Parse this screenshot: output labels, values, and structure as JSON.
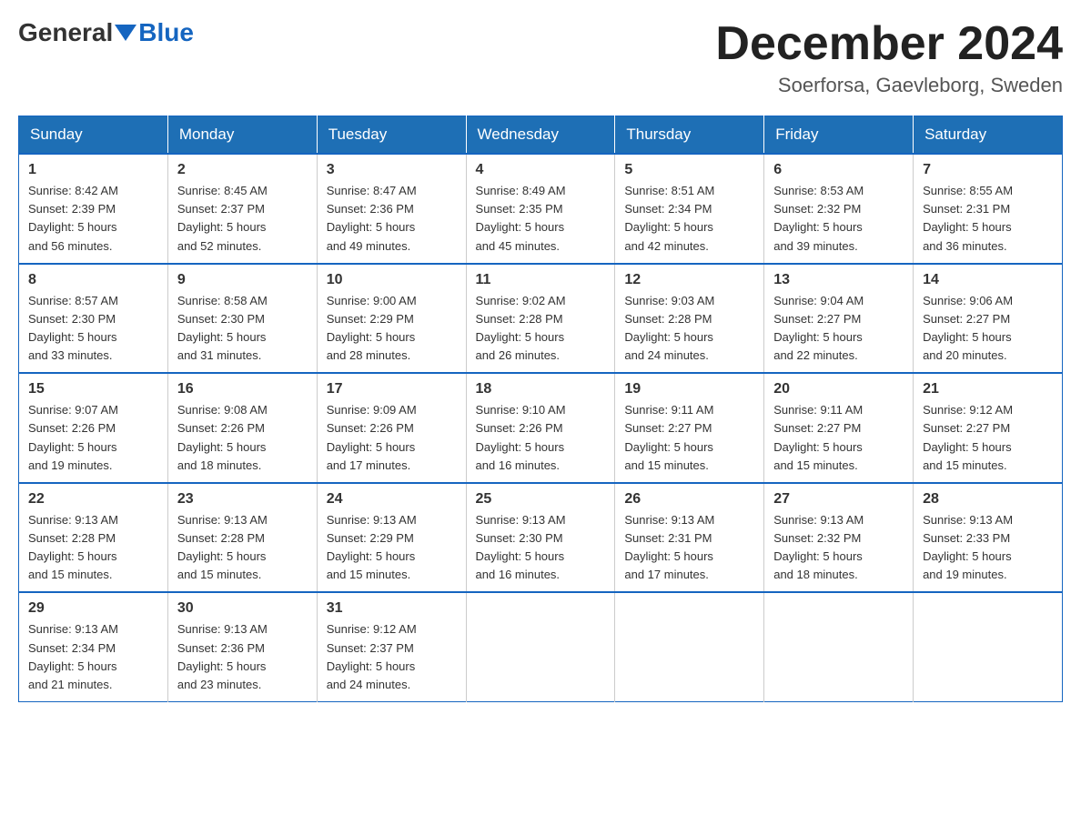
{
  "header": {
    "logo_general": "General",
    "logo_blue": "Blue",
    "month_title": "December 2024",
    "location": "Soerforsa, Gaevleborg, Sweden"
  },
  "days_of_week": [
    "Sunday",
    "Monday",
    "Tuesday",
    "Wednesday",
    "Thursday",
    "Friday",
    "Saturday"
  ],
  "weeks": [
    [
      {
        "day": "1",
        "sunrise": "8:42 AM",
        "sunset": "2:39 PM",
        "daylight": "5 hours and 56 minutes."
      },
      {
        "day": "2",
        "sunrise": "8:45 AM",
        "sunset": "2:37 PM",
        "daylight": "5 hours and 52 minutes."
      },
      {
        "day": "3",
        "sunrise": "8:47 AM",
        "sunset": "2:36 PM",
        "daylight": "5 hours and 49 minutes."
      },
      {
        "day": "4",
        "sunrise": "8:49 AM",
        "sunset": "2:35 PM",
        "daylight": "5 hours and 45 minutes."
      },
      {
        "day": "5",
        "sunrise": "8:51 AM",
        "sunset": "2:34 PM",
        "daylight": "5 hours and 42 minutes."
      },
      {
        "day": "6",
        "sunrise": "8:53 AM",
        "sunset": "2:32 PM",
        "daylight": "5 hours and 39 minutes."
      },
      {
        "day": "7",
        "sunrise": "8:55 AM",
        "sunset": "2:31 PM",
        "daylight": "5 hours and 36 minutes."
      }
    ],
    [
      {
        "day": "8",
        "sunrise": "8:57 AM",
        "sunset": "2:30 PM",
        "daylight": "5 hours and 33 minutes."
      },
      {
        "day": "9",
        "sunrise": "8:58 AM",
        "sunset": "2:30 PM",
        "daylight": "5 hours and 31 minutes."
      },
      {
        "day": "10",
        "sunrise": "9:00 AM",
        "sunset": "2:29 PM",
        "daylight": "5 hours and 28 minutes."
      },
      {
        "day": "11",
        "sunrise": "9:02 AM",
        "sunset": "2:28 PM",
        "daylight": "5 hours and 26 minutes."
      },
      {
        "day": "12",
        "sunrise": "9:03 AM",
        "sunset": "2:28 PM",
        "daylight": "5 hours and 24 minutes."
      },
      {
        "day": "13",
        "sunrise": "9:04 AM",
        "sunset": "2:27 PM",
        "daylight": "5 hours and 22 minutes."
      },
      {
        "day": "14",
        "sunrise": "9:06 AM",
        "sunset": "2:27 PM",
        "daylight": "5 hours and 20 minutes."
      }
    ],
    [
      {
        "day": "15",
        "sunrise": "9:07 AM",
        "sunset": "2:26 PM",
        "daylight": "5 hours and 19 minutes."
      },
      {
        "day": "16",
        "sunrise": "9:08 AM",
        "sunset": "2:26 PM",
        "daylight": "5 hours and 18 minutes."
      },
      {
        "day": "17",
        "sunrise": "9:09 AM",
        "sunset": "2:26 PM",
        "daylight": "5 hours and 17 minutes."
      },
      {
        "day": "18",
        "sunrise": "9:10 AM",
        "sunset": "2:26 PM",
        "daylight": "5 hours and 16 minutes."
      },
      {
        "day": "19",
        "sunrise": "9:11 AM",
        "sunset": "2:27 PM",
        "daylight": "5 hours and 15 minutes."
      },
      {
        "day": "20",
        "sunrise": "9:11 AM",
        "sunset": "2:27 PM",
        "daylight": "5 hours and 15 minutes."
      },
      {
        "day": "21",
        "sunrise": "9:12 AM",
        "sunset": "2:27 PM",
        "daylight": "5 hours and 15 minutes."
      }
    ],
    [
      {
        "day": "22",
        "sunrise": "9:13 AM",
        "sunset": "2:28 PM",
        "daylight": "5 hours and 15 minutes."
      },
      {
        "day": "23",
        "sunrise": "9:13 AM",
        "sunset": "2:28 PM",
        "daylight": "5 hours and 15 minutes."
      },
      {
        "day": "24",
        "sunrise": "9:13 AM",
        "sunset": "2:29 PM",
        "daylight": "5 hours and 15 minutes."
      },
      {
        "day": "25",
        "sunrise": "9:13 AM",
        "sunset": "2:30 PM",
        "daylight": "5 hours and 16 minutes."
      },
      {
        "day": "26",
        "sunrise": "9:13 AM",
        "sunset": "2:31 PM",
        "daylight": "5 hours and 17 minutes."
      },
      {
        "day": "27",
        "sunrise": "9:13 AM",
        "sunset": "2:32 PM",
        "daylight": "5 hours and 18 minutes."
      },
      {
        "day": "28",
        "sunrise": "9:13 AM",
        "sunset": "2:33 PM",
        "daylight": "5 hours and 19 minutes."
      }
    ],
    [
      {
        "day": "29",
        "sunrise": "9:13 AM",
        "sunset": "2:34 PM",
        "daylight": "5 hours and 21 minutes."
      },
      {
        "day": "30",
        "sunrise": "9:13 AM",
        "sunset": "2:36 PM",
        "daylight": "5 hours and 23 minutes."
      },
      {
        "day": "31",
        "sunrise": "9:12 AM",
        "sunset": "2:37 PM",
        "daylight": "5 hours and 24 minutes."
      },
      null,
      null,
      null,
      null
    ]
  ],
  "labels": {
    "sunrise": "Sunrise:",
    "sunset": "Sunset:",
    "daylight": "Daylight:"
  }
}
